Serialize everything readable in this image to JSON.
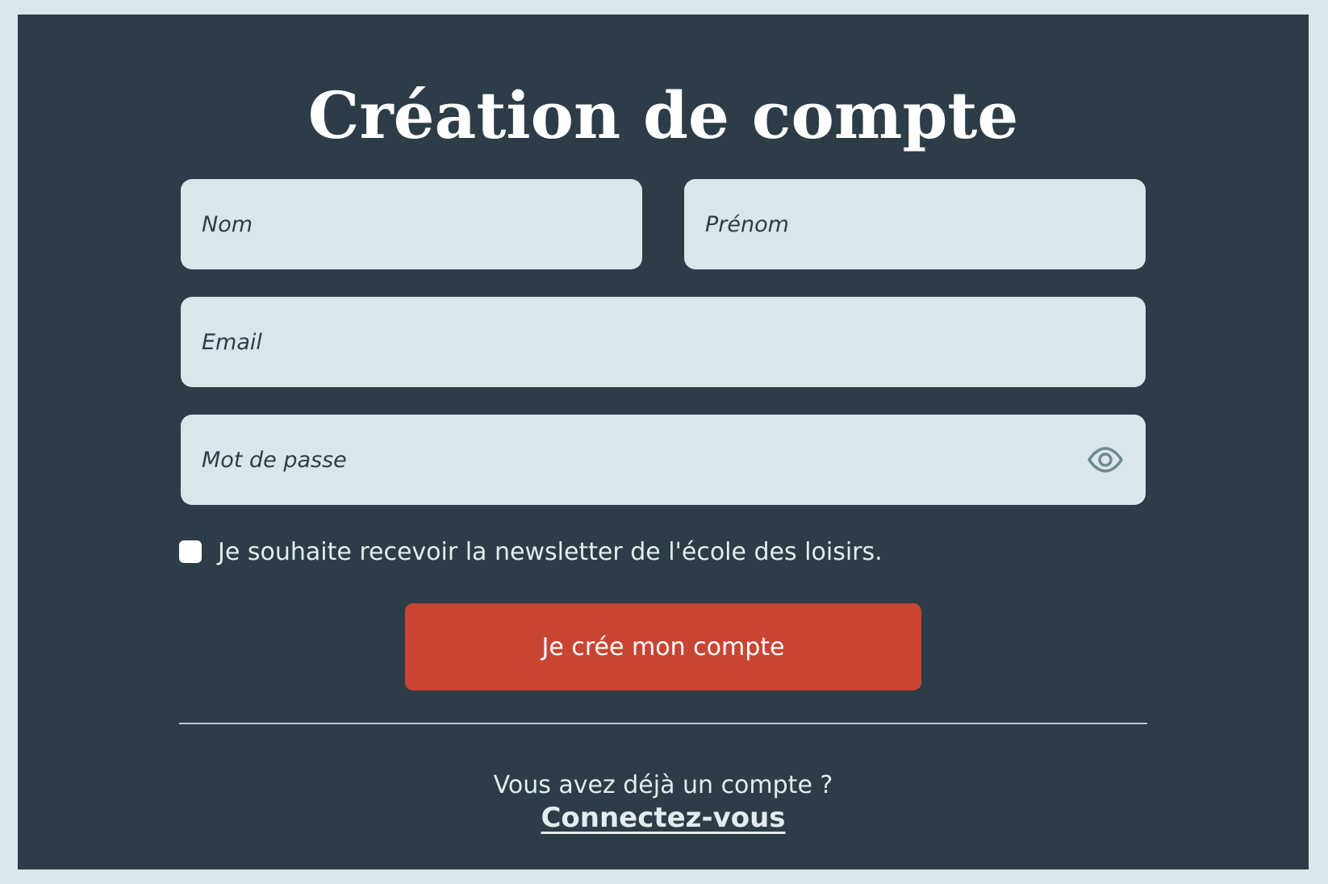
{
  "form": {
    "title": "Création de compte",
    "fields": {
      "nom_placeholder": "Nom",
      "nom_value": "",
      "prenom_placeholder": "Prénom",
      "prenom_value": "",
      "email_placeholder": "Email",
      "email_value": "",
      "password_placeholder": "Mot de passe",
      "password_value": ""
    },
    "password_toggle_icon": "eye-icon",
    "newsletter": {
      "checked": false,
      "label": "Je souhaite recevoir la newsletter de l'école des loisirs."
    },
    "submit_label": "Je crée mon compte",
    "already_account_text": "Vous avez déjà un compte ?",
    "login_link_label": "Connectez-vous"
  },
  "colors": {
    "page_background": "#d9e7ec",
    "panel_background": "#2c3d48",
    "field_background": "#d9e7ec",
    "accent_button": "#c94533",
    "text_light": "#e3ecf0"
  }
}
